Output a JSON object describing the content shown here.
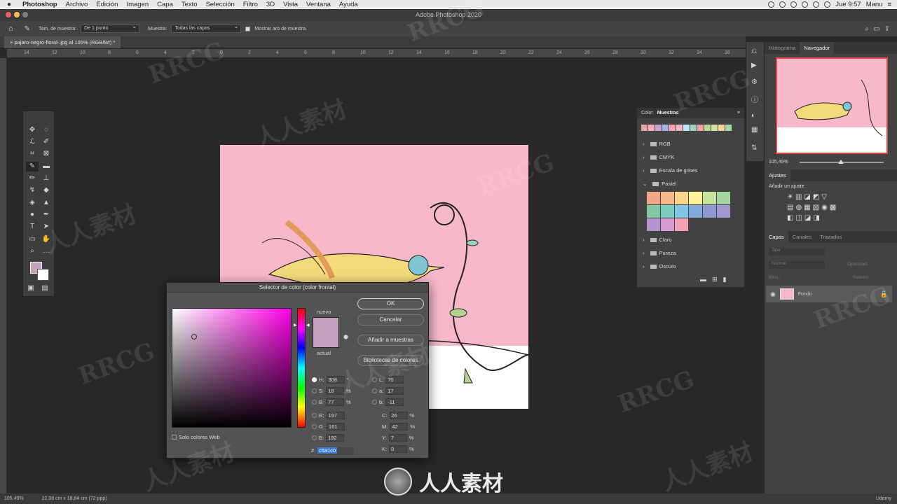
{
  "menubar": {
    "apple": "",
    "items": [
      "Photoshop",
      "Archivo",
      "Edición",
      "Imagen",
      "Capa",
      "Texto",
      "Selección",
      "Filtro",
      "3D",
      "Vista",
      "Ventana",
      "Ayuda"
    ],
    "clock": "Jue 9:57",
    "user": "Manu"
  },
  "window": {
    "title": "Adobe Photoshop 2020"
  },
  "options": {
    "sample_size_label": "Tam. de muestra:",
    "sample_size": "De 1 punto",
    "sample_label": "Muestra:",
    "sample": "Todas las capas",
    "show_ring": "Mostrar aro de muestra"
  },
  "document": {
    "tab": "pajaro-negro-floral-.jpg al 105% (RGB/8#) *"
  },
  "ruler": {
    "h": [
      "14",
      "12",
      "10",
      "8",
      "6",
      "4",
      "2",
      "0",
      "2",
      "4",
      "6",
      "8",
      "10",
      "12",
      "14",
      "16",
      "18",
      "20",
      "22",
      "24",
      "26",
      "28",
      "30",
      "32",
      "34",
      "36",
      "38"
    ]
  },
  "navigator": {
    "tabs": [
      "Histograma",
      "Navegador"
    ],
    "zoom": "105,49%"
  },
  "adjust": {
    "title": "Ajustes",
    "add": "Añadir un ajuste"
  },
  "layers": {
    "tabs": [
      "Capas",
      "Canales",
      "Trazados"
    ],
    "kind": "Tipo",
    "mode": "Normal",
    "opacity": "Opacidad:",
    "lock": "Bloq.:",
    "fill": "Relleno:",
    "layer_name": "Fondo"
  },
  "swatches": {
    "tabs": [
      "Color",
      "Muestras"
    ],
    "top_colors": [
      "#e9a4a9",
      "#f5b0b9",
      "#c7a6cf",
      "#a1b4df",
      "#f8a7b2",
      "#f4b8c5",
      "#c5e6f5",
      "#9fd0c4",
      "#f0a4a0",
      "#bcd79e",
      "#d4e3a2",
      "#f5d69d",
      "#a8d8a6"
    ],
    "folders": [
      "RGB",
      "CMYK",
      "Escala de grises",
      "Pastel",
      "Claro",
      "Pureza",
      "Oscuro"
    ],
    "pastel": [
      "#f4a689",
      "#f8b98a",
      "#fcd48e",
      "#fef29a",
      "#c7e29d",
      "#a4d49f",
      "#82c8a4",
      "#7bcbbf",
      "#7dc6e6",
      "#82aadc",
      "#8f9ad2",
      "#a196cf",
      "#b694cf",
      "#d59ad0",
      "#f4a0b1"
    ]
  },
  "dialog": {
    "title": "Selector de color (color frontal)",
    "new_label": "nuevo",
    "current_label": "actual",
    "ok": "OK",
    "cancel": "Cancelar",
    "add_swatch": "Añadir a muestras",
    "libraries": "Bibliotecas de colores",
    "web_only": "Solo colores Web",
    "hsb": [
      {
        "k": "H:",
        "v": "308",
        "u": "°"
      },
      {
        "k": "S:",
        "v": "18",
        "u": "%"
      },
      {
        "k": "B:",
        "v": "77",
        "u": "%"
      }
    ],
    "rgb": [
      {
        "k": "R:",
        "v": "197"
      },
      {
        "k": "G:",
        "v": "161"
      },
      {
        "k": "B:",
        "v": "192"
      }
    ],
    "lab": [
      {
        "k": "L:",
        "v": "70"
      },
      {
        "k": "a:",
        "v": "17"
      },
      {
        "k": "b:",
        "v": "-11"
      }
    ],
    "cmyk": [
      {
        "k": "C:",
        "v": "26",
        "u": "%"
      },
      {
        "k": "M:",
        "v": "42",
        "u": "%"
      },
      {
        "k": "Y:",
        "v": "7",
        "u": "%"
      },
      {
        "k": "K:",
        "v": "0",
        "u": "%"
      }
    ],
    "hex_label": "#",
    "hex": "c5a1c0",
    "new_color": "#c5a1c0"
  },
  "status": {
    "zoom": "105,49%",
    "size": "22,08 cm x 18,84 cm (72 ppp)",
    "brand": "Udemy"
  },
  "watermarks": [
    "RRCG",
    "人人素材"
  ],
  "logo": {
    "text": "人人素材"
  }
}
